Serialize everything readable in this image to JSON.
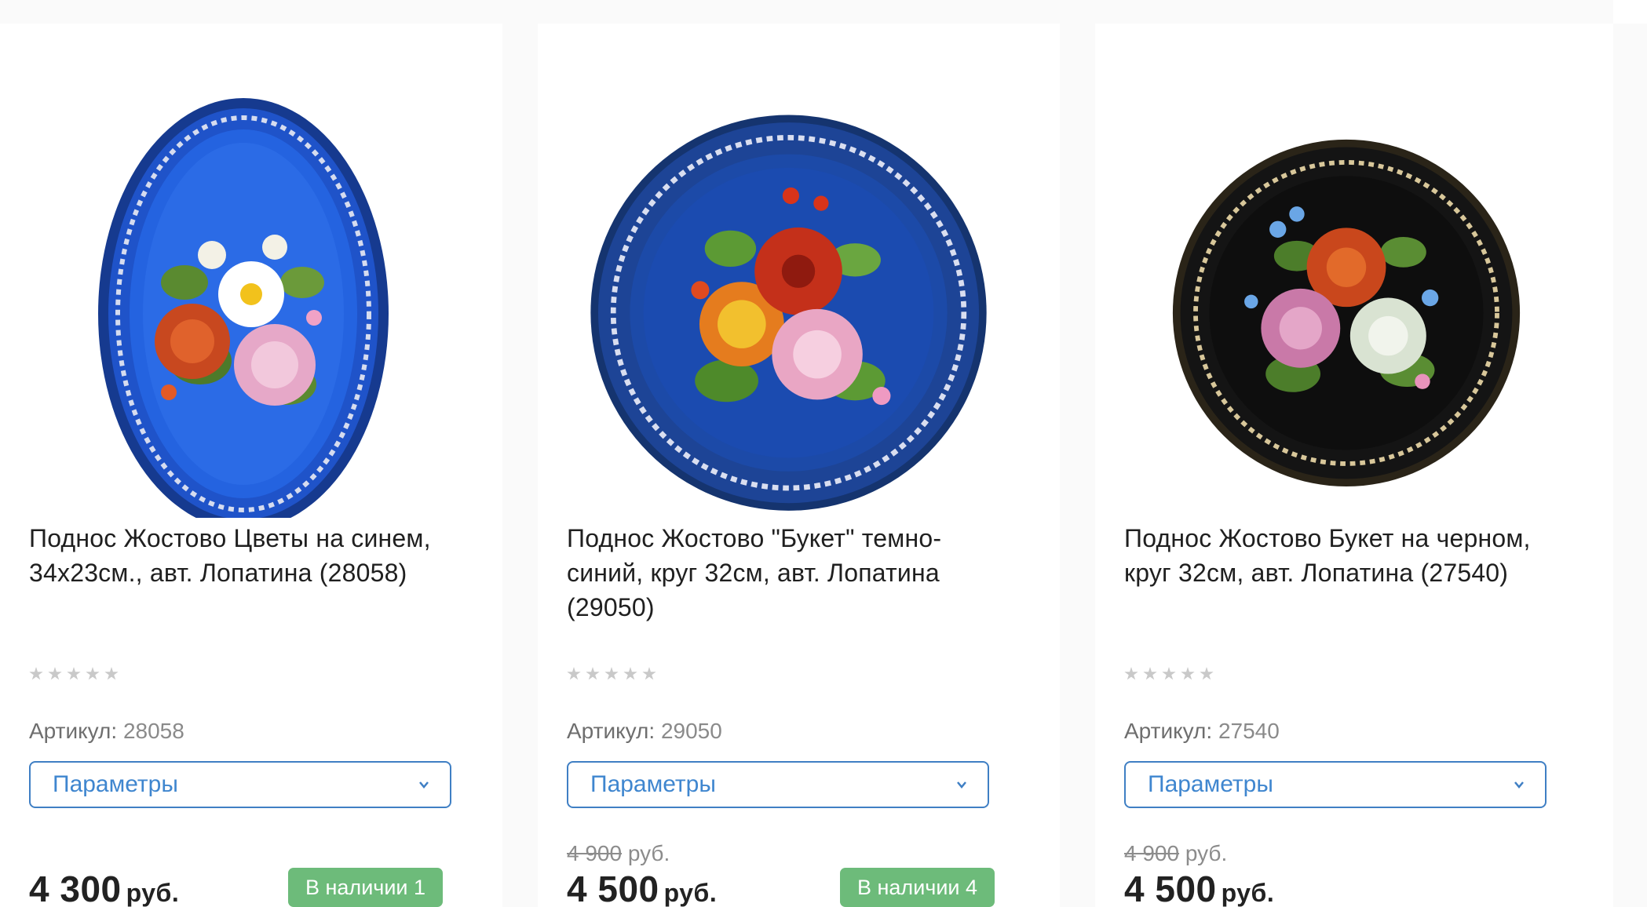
{
  "colors": {
    "accent": "#3f86cf",
    "stock_badge": "#6dbb7a",
    "star": "#c9c9c9",
    "tray_blue": "#1e4fc4",
    "tray_dark_blue": "#1d4496",
    "tray_black": "#111111"
  },
  "products": [
    {
      "image_icon": "tray-blue-oval-flowers",
      "title": "Поднос Жостово Цветы на синем, 34х23см., авт. Лопатина (28058)",
      "rating_stars": 5,
      "sku_label": "Артикул:",
      "sku_value": "28058",
      "params_label": "Параметры",
      "old_price": "",
      "old_price_currency": "",
      "price": "4 300",
      "currency": "руб.",
      "stock": "В наличии 1"
    },
    {
      "image_icon": "tray-dark-blue-round-bouquet",
      "title": "Поднос Жостово \"Букет\" темно-синий, круг 32см, авт. Лопатина (29050)",
      "rating_stars": 5,
      "sku_label": "Артикул:",
      "sku_value": "29050",
      "params_label": "Параметры",
      "old_price": "4 900",
      "old_price_currency": "руб.",
      "price": "4 500",
      "currency": "руб.",
      "stock": "В наличии 4"
    },
    {
      "image_icon": "tray-black-round-bouquet",
      "title": "Поднос Жостово Букет на черном, круг 32см, авт. Лопатина (27540)",
      "rating_stars": 5,
      "sku_label": "Артикул:",
      "sku_value": "27540",
      "params_label": "Параметры",
      "old_price": "4 900",
      "old_price_currency": "руб.",
      "price": "4 500",
      "currency": "руб.",
      "stock": ""
    }
  ]
}
